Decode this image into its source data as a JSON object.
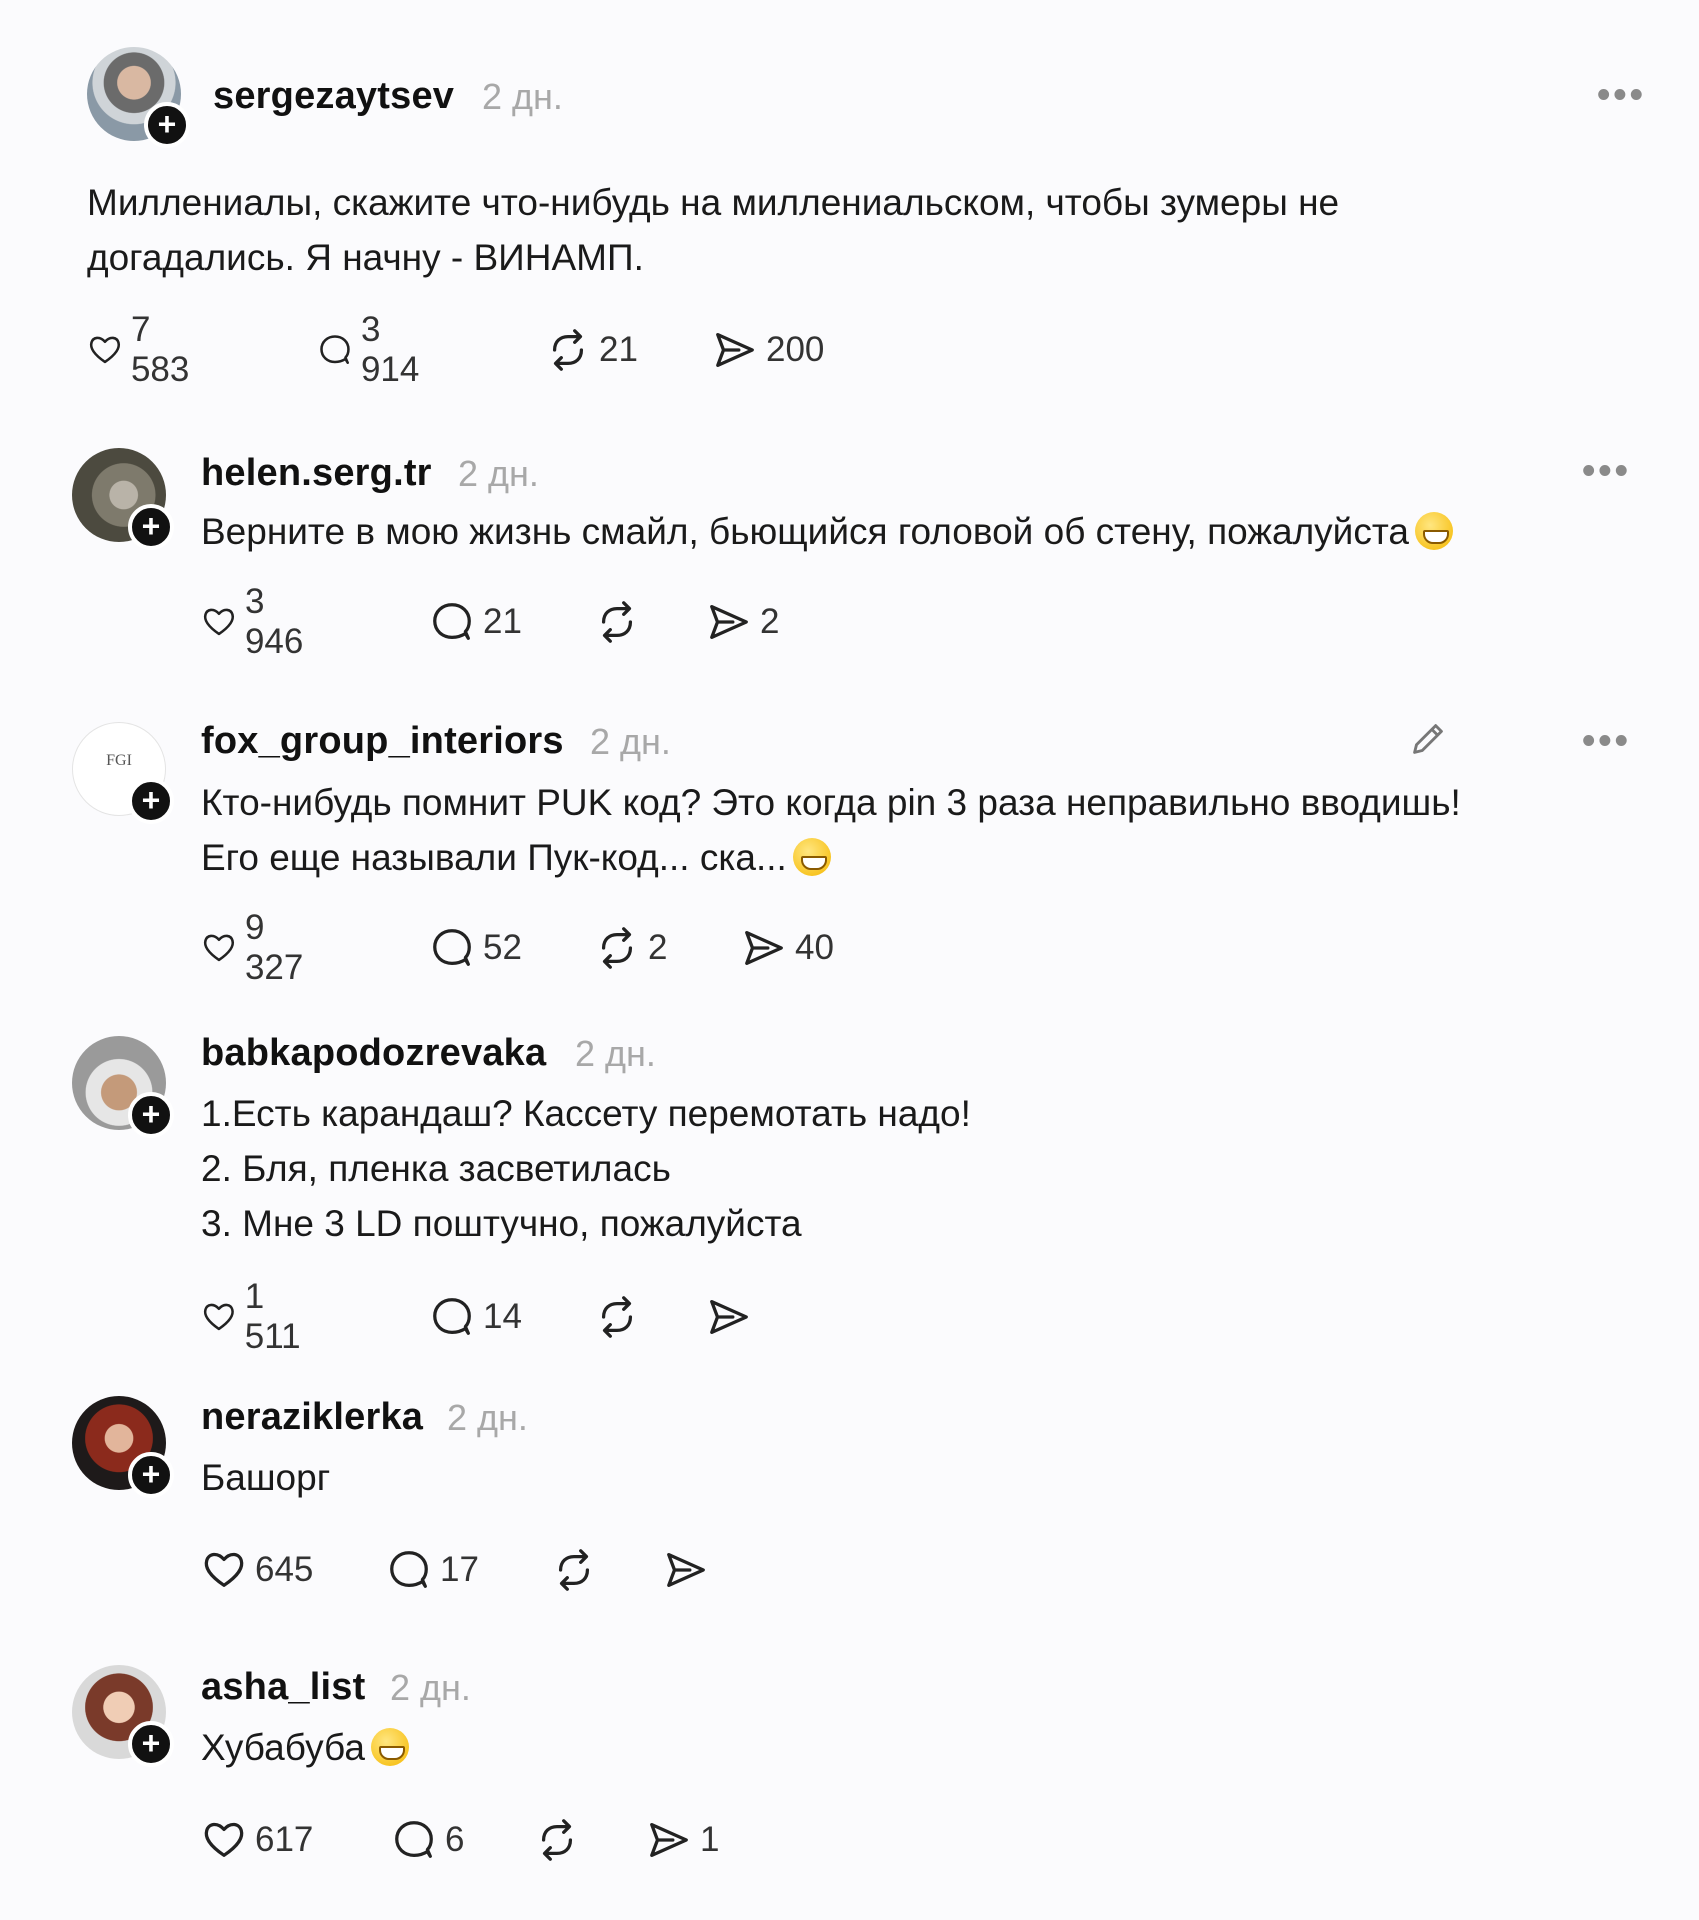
{
  "main_post": {
    "username": "sergezaytsev",
    "time": "2 дн.",
    "text_line1": "Миллениалы, скажите что-нибудь на миллениальском, чтобы зумеры не",
    "text_line2": "догадались. Я начну - ВИНАМП.",
    "likes": "7 583",
    "replies": "3 914",
    "reposts": "21",
    "shares": "200"
  },
  "comments": [
    {
      "username": "helen.serg.tr",
      "time": "2 дн.",
      "lines": [
        "Верните в мою жизнь смайл, бьющийся головой об стену, пожалуйста"
      ],
      "likes": "3 946",
      "replies": "21",
      "reposts": "",
      "shares": "2"
    },
    {
      "username": "fox_group_interiors",
      "time": "2 дн.",
      "avatar_text": "FGI",
      "lines": [
        "Кто-нибудь помнит PUK код? Это когда pin 3 раза неправильно вводишь!",
        "Его еще называли Пук-код... ска..."
      ],
      "likes": "9 327",
      "replies": "52",
      "reposts": "2",
      "shares": "40"
    },
    {
      "username": "babkapodozrevaka",
      "time": "2 дн.",
      "lines": [
        "1.Есть карандаш? Кассету перемотать надо!",
        "2. Бля, пленка засветилась",
        "3. Мне 3 LD поштучно, пожалуйста"
      ],
      "likes": "1 511",
      "replies": "14",
      "reposts": "",
      "shares": ""
    },
    {
      "username": "neraziklerka",
      "time": "2 дн.",
      "lines": [
        "Башорг"
      ],
      "likes": "645",
      "replies": "17",
      "reposts": "",
      "shares": ""
    },
    {
      "username": "asha_list",
      "time": "2 дн.",
      "lines": [
        "Хубабуба"
      ],
      "likes": "617",
      "replies": "6",
      "reposts": "",
      "shares": "1"
    }
  ],
  "icons": {
    "more": "more-dots-icon",
    "like": "heart-icon",
    "reply": "comment-bubble-icon",
    "repost": "repost-arrows-icon",
    "share": "send-icon",
    "edit": "pencil-icon",
    "follow": "plus-icon"
  },
  "colors": {
    "text": "#111111",
    "muted": "#a8a8a8",
    "background": "#fbfbfd"
  }
}
